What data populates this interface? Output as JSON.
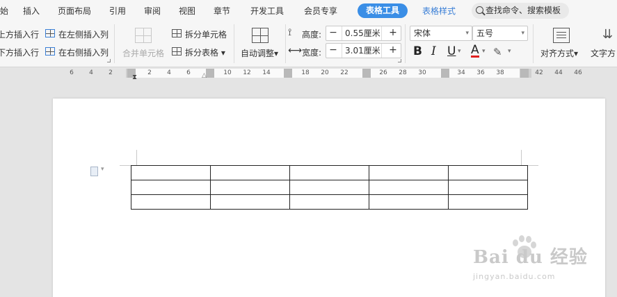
{
  "menu": {
    "tabs": [
      "始",
      "插入",
      "页面布局",
      "引用",
      "审阅",
      "视图",
      "章节",
      "开发工具",
      "会员专享"
    ],
    "active_tab": "表格工具",
    "style_tab": "表格样式",
    "search_placeholder": "查找命令、搜索模板"
  },
  "ribbon": {
    "insert_above": "上方插入行",
    "insert_below": "下方插入行",
    "insert_left_col": "在左侧插入列",
    "insert_right_col": "在右侧插入列",
    "merge_cells": "合并单元格",
    "split_cells": "拆分单元格",
    "split_table": "拆分表格",
    "auto_adjust": "自动调整",
    "height_label": "高度:",
    "height_value": "0.55厘米",
    "width_label": "宽度:",
    "width_value": "3.01厘米",
    "font_name": "宋体",
    "font_size": "五号",
    "bold": "B",
    "italic": "I",
    "underline": "U",
    "font_color": "A",
    "align": "对齐方式",
    "text_dir": "文字方"
  },
  "ruler": {
    "left_ticks": [
      "6",
      "4",
      "2"
    ],
    "mid_ticks": [
      "2",
      "4",
      "6",
      "10",
      "12",
      "14",
      "18",
      "20",
      "22",
      "26",
      "28",
      "30",
      "34",
      "36",
      "38",
      "42",
      "44",
      "46"
    ]
  },
  "table": {
    "rows": 3,
    "cols": 5
  },
  "watermark": {
    "brand": "Bai du 经验",
    "url": "jingyan.baidu.com"
  },
  "colors": {
    "accent": "#3a8ee6",
    "font_red": "#e02020"
  }
}
